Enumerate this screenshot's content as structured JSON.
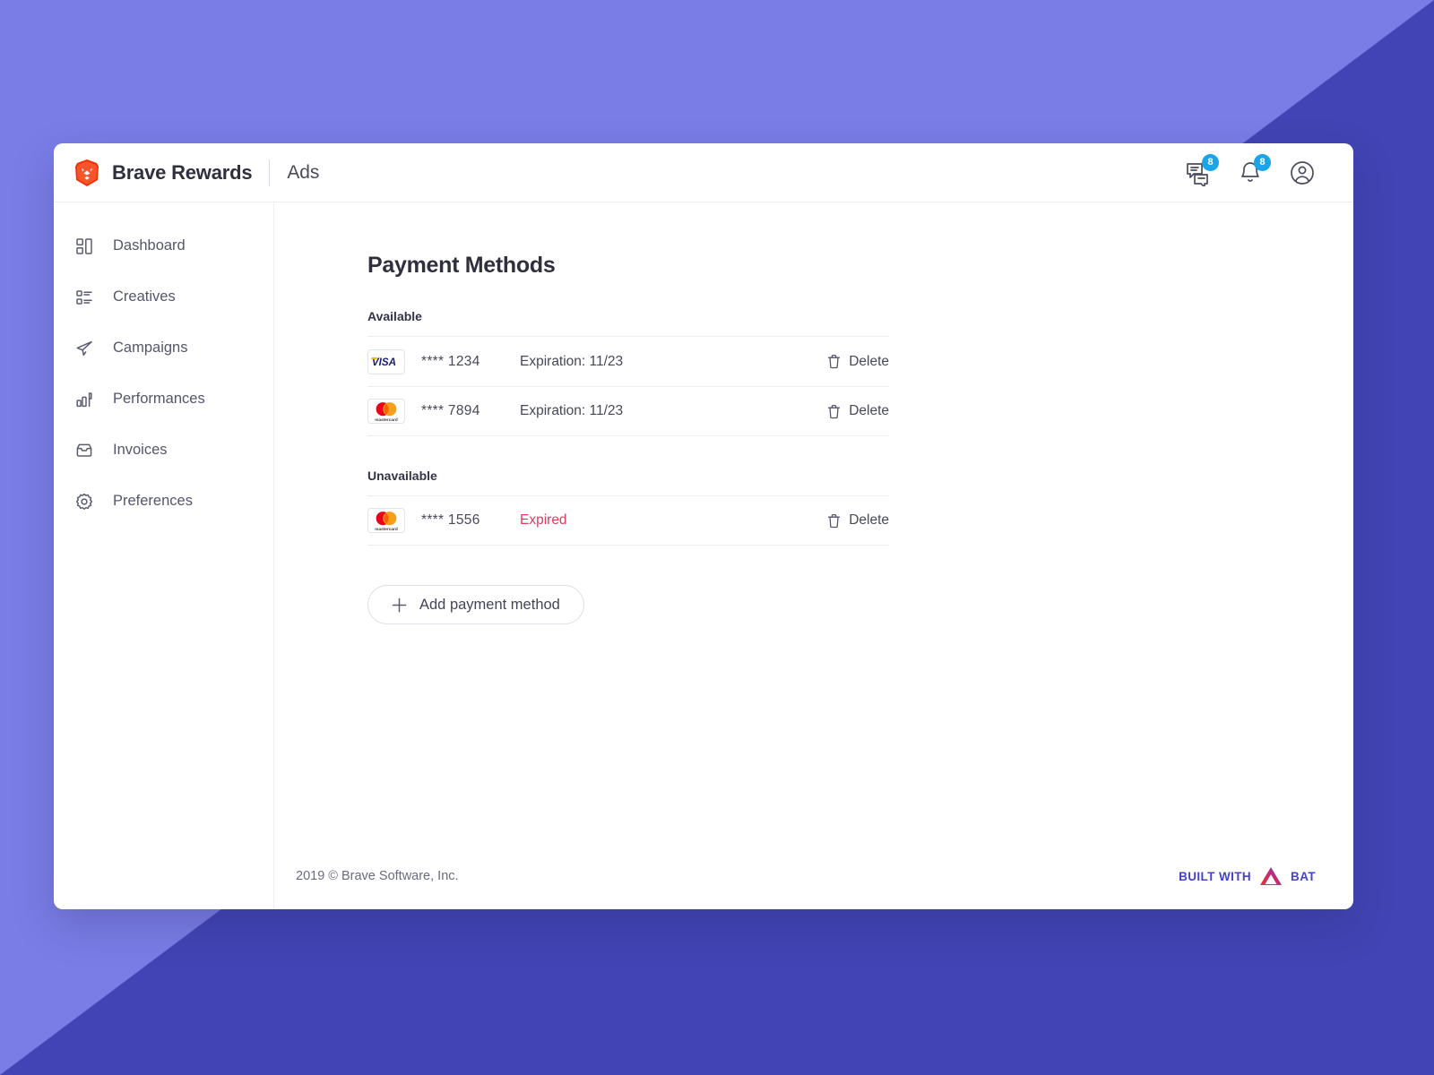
{
  "background": {
    "light": "#7a7de6",
    "dark": "#4244b5"
  },
  "header": {
    "brand_name": "Brave Rewards",
    "brand_logo_icon": "brave-lion-icon",
    "section_name": "Ads",
    "icons": [
      {
        "name": "messages-icon",
        "badge": "8"
      },
      {
        "name": "notifications-bell-icon",
        "badge": "8"
      },
      {
        "name": "account-avatar-icon",
        "badge": ""
      }
    ],
    "badge_color": "#1ba4e8"
  },
  "sidebar": {
    "items": [
      {
        "label": "Dashboard",
        "icon": "dashboard-icon"
      },
      {
        "label": "Creatives",
        "icon": "creatives-list-icon"
      },
      {
        "label": "Campaigns",
        "icon": "paper-plane-icon"
      },
      {
        "label": "Performances",
        "icon": "bar-chart-icon"
      },
      {
        "label": "Invoices",
        "icon": "inbox-icon"
      },
      {
        "label": "Preferences",
        "icon": "gear-icon"
      }
    ]
  },
  "main": {
    "page_title": "Payment Methods",
    "groups": [
      {
        "label": "Available",
        "rows": [
          {
            "brand": "visa",
            "digits": "**** 1234",
            "status": "Expiration: 11/23",
            "expired": false,
            "delete_label": "Delete"
          },
          {
            "brand": "mastercard",
            "digits": "**** 7894",
            "status": "Expiration: 11/23",
            "expired": false,
            "delete_label": "Delete"
          }
        ]
      },
      {
        "label": "Unavailable",
        "rows": [
          {
            "brand": "mastercard",
            "digits": "**** 1556",
            "status": "Expired",
            "expired": true,
            "delete_label": "Delete"
          }
        ]
      }
    ],
    "add_button_label": "Add payment method",
    "expired_color": "#e03a5f"
  },
  "footer": {
    "copyright": "2019 © Brave Software, Inc.",
    "bat_prefix": "BUILT WITH",
    "bat_suffix": "BAT",
    "bat_color": "#4543c9"
  }
}
